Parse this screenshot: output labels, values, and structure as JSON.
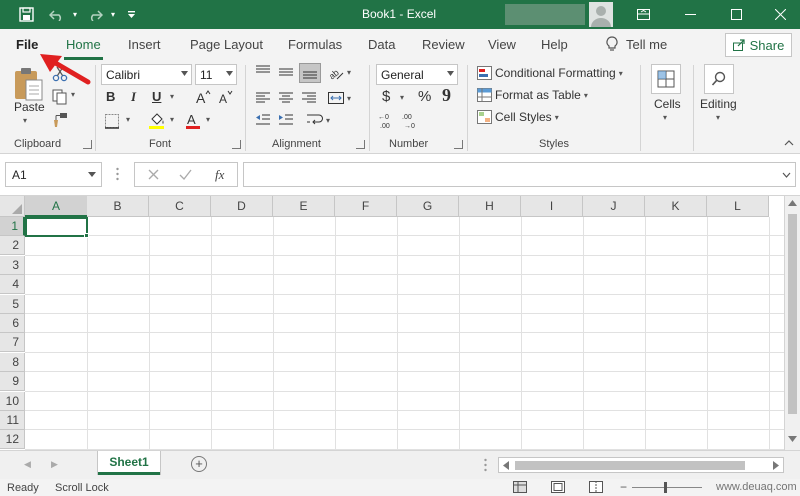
{
  "titlebar": {
    "doc_title": "Book1  -  Excel",
    "icons": [
      "save-icon",
      "undo-icon",
      "redo-icon",
      "customize-qat-icon",
      "account-avatar-icon",
      "ribbon-display-icon",
      "minimize-icon",
      "maximize-icon",
      "close-icon"
    ],
    "bg_color": "#217346"
  },
  "tabs": {
    "file": "File",
    "home": "Home",
    "insert": "Insert",
    "page_layout": "Page Layout",
    "formulas": "Formulas",
    "data": "Data",
    "review": "Review",
    "view": "View",
    "help": "Help",
    "tell_me": "Tell me",
    "share": "Share"
  },
  "ribbon": {
    "clipboard": {
      "label": "Clipboard",
      "paste": "Paste"
    },
    "font": {
      "label": "Font",
      "name": "Calibri",
      "size": "11",
      "bold": "B",
      "italic": "I",
      "underline": "U"
    },
    "alignment": {
      "label": "Alignment"
    },
    "number": {
      "label": "Number",
      "format": "General",
      "currency": "$",
      "percent": "%",
      "comma": "9"
    },
    "styles": {
      "label": "Styles",
      "conditional_formatting": "Conditional Formatting",
      "format_as_table": "Format as Table",
      "cell_styles": "Cell Styles"
    },
    "cells": {
      "label": "Cells"
    },
    "editing": {
      "label": "Editing"
    }
  },
  "formula_bar": {
    "name_box": "A1",
    "fx": "fx",
    "value": ""
  },
  "grid": {
    "columns": [
      "A",
      "B",
      "C",
      "D",
      "E",
      "F",
      "G",
      "H",
      "I",
      "J",
      "K",
      "L"
    ],
    "rows": [
      "1",
      "2",
      "3",
      "4",
      "5",
      "6",
      "7",
      "8",
      "9",
      "10",
      "11",
      "12"
    ],
    "active_cell": "A1"
  },
  "sheets": {
    "tabs": [
      "Sheet1"
    ],
    "active": "Sheet1"
  },
  "status": {
    "ready": "Ready",
    "scroll_lock": "Scroll Lock"
  },
  "watermark": "www.deuaq.com",
  "accent_color": "#217346",
  "annotation_color": "#e02020"
}
